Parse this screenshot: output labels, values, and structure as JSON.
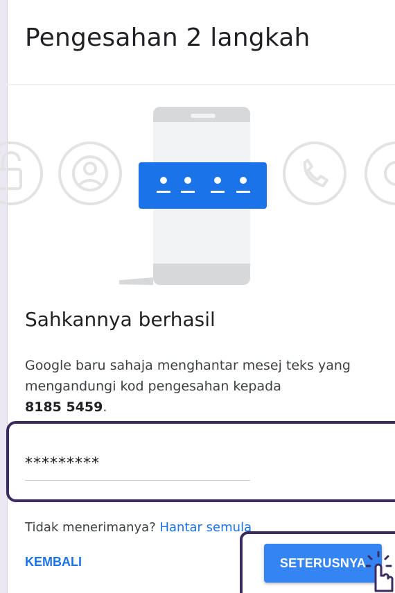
{
  "page": {
    "title": "Pengesahan 2 langkah"
  },
  "illustration": {
    "icons": [
      "lock-icon",
      "account-icon",
      "phone-call-icon",
      "settings-icon"
    ],
    "code_bar_color": "#1a73e8"
  },
  "verification": {
    "heading": "Sahkannya berhasil",
    "description": "Google baru sahaja menghantar mesej teks yang mengandungi kod pengesahan kepada",
    "phone_number": "8185 5459",
    "phone_suffix": ".",
    "code_value": "*********"
  },
  "resend": {
    "question": "Tidak menerimanya?",
    "link_label": "Hantar semula"
  },
  "actions": {
    "back_label": "KEMBALI",
    "next_label": "SETERUSNYA"
  },
  "colors": {
    "accent": "#1a73e8",
    "button": "#3584f3",
    "highlight_border": "#3a2c5e",
    "background": "#ece8f3"
  }
}
